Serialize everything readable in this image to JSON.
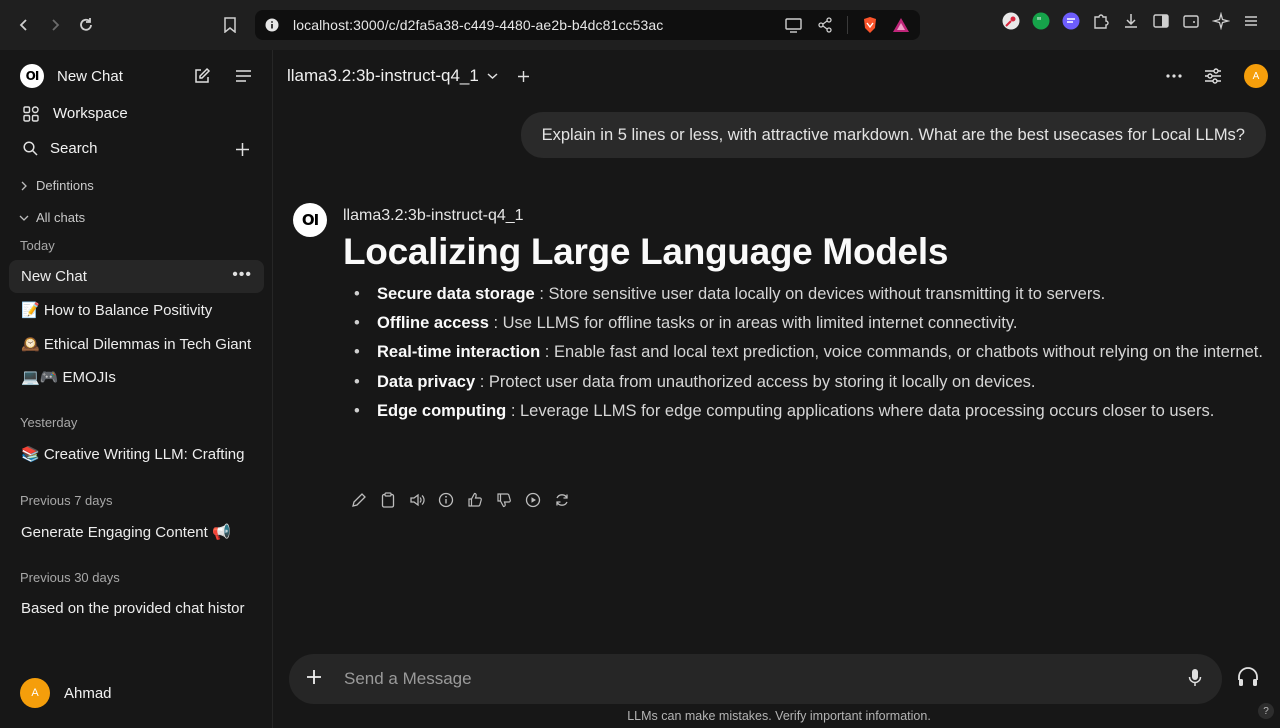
{
  "browser": {
    "url": "localhost:3000/c/d2fa5a38-c449-4480-ae2b-b4dc81cc53ac"
  },
  "sidebar": {
    "logo_text": "OI",
    "new_chat_label": "New Chat",
    "workspace_label": "Workspace",
    "search_label": "Search",
    "folders": [
      {
        "label": "Defintions",
        "expanded": false
      },
      {
        "label": "All chats",
        "expanded": true
      }
    ],
    "sections": [
      {
        "title": "Today",
        "items": [
          {
            "label": "New Chat",
            "active": true
          },
          {
            "label": "📝 How to Balance Positivity"
          },
          {
            "label": "🕰️ Ethical Dilemmas in Tech Giant"
          },
          {
            "label": "💻🎮 EMOJIs"
          }
        ]
      },
      {
        "title": "Yesterday",
        "items": [
          {
            "label": "📚 Creative Writing LLM: Crafting"
          }
        ]
      },
      {
        "title": "Previous 7 days",
        "items": [
          {
            "label": "Generate Engaging Content 📢"
          }
        ]
      },
      {
        "title": "Previous 30 days",
        "items": [
          {
            "label": "Based on the provided chat histor"
          }
        ]
      }
    ],
    "user": {
      "initial": "A",
      "name": "Ahmad"
    }
  },
  "header": {
    "model_name": "llama3.2:3b-instruct-q4_1",
    "avatar_initial": "A"
  },
  "conversation": {
    "user_message": "Explain in 5 lines or less, with attractive markdown. What are the best usecases for Local LLMs?",
    "assistant": {
      "logo_text": "OI",
      "model_name": "llama3.2:3b-instruct-q4_1",
      "heading": "Localizing Large Language Models",
      "bullets": [
        {
          "title": "Secure data storage",
          "text": " : Store sensitive user data locally on devices without transmitting it to servers."
        },
        {
          "title": "Offline access",
          "text": " : Use LLMS for offline tasks or in areas with limited internet connectivity."
        },
        {
          "title": "Real-time interaction",
          "text": " : Enable fast and local text prediction, voice commands, or chatbots without relying on the internet."
        },
        {
          "title": "Data privacy",
          "text": " : Protect user data from unauthorized access by storing it locally on devices."
        },
        {
          "title": "Edge computing",
          "text": " : Leverage LLMS for edge computing applications where data processing occurs closer to users."
        }
      ]
    }
  },
  "composer": {
    "placeholder": "Send a Message"
  },
  "footer": {
    "disclaimer": "LLMs can make mistakes. Verify important information.",
    "help": "?"
  },
  "colors": {
    "background": "#171717",
    "bubble": "#2a2a2a",
    "avatar": "#f59e0b"
  }
}
